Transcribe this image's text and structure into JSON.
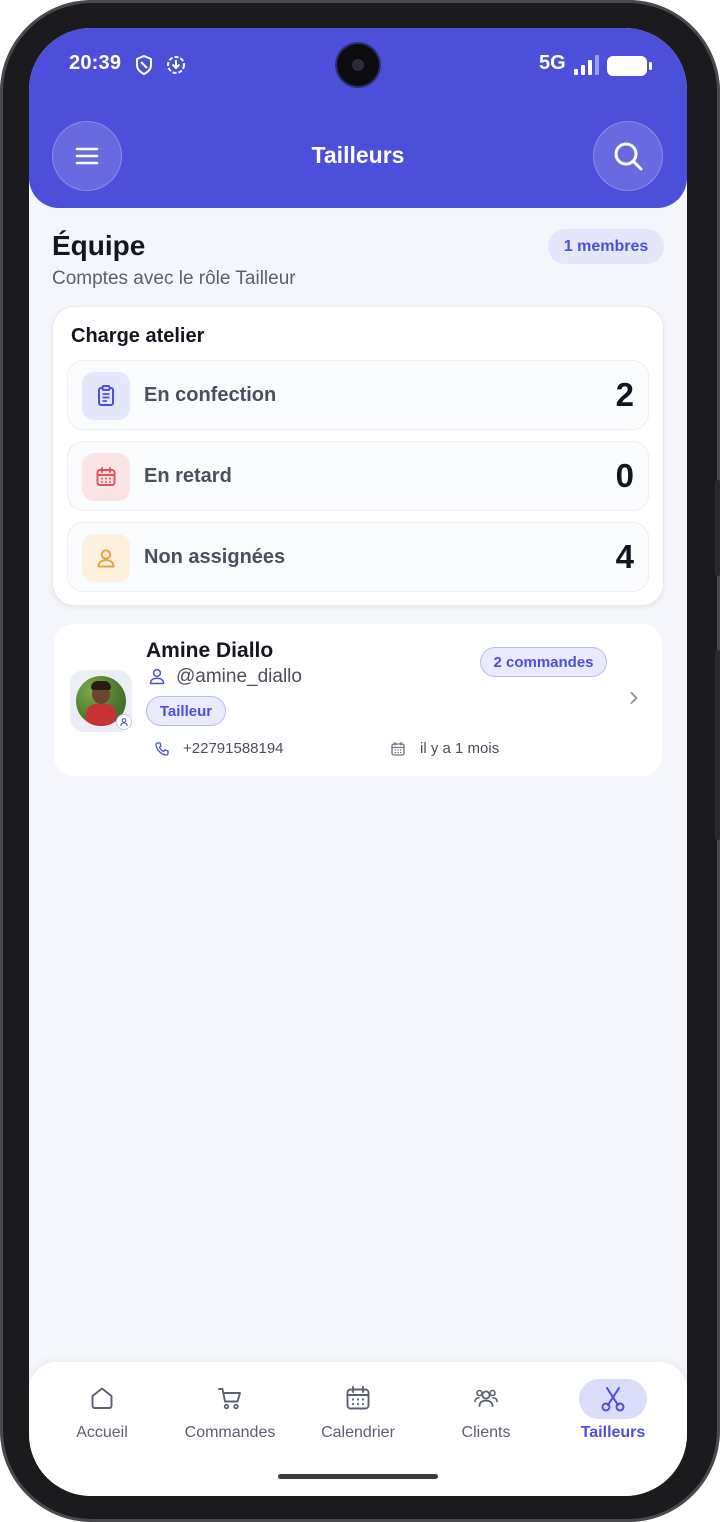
{
  "status_bar": {
    "time": "20:39",
    "network": "5G"
  },
  "header": {
    "title": "Tailleurs",
    "menu_icon": "hamburger-menu-icon",
    "search_icon": "search-icon",
    "background_color": "#4c4fda"
  },
  "team": {
    "title": "Équipe",
    "subtitle": "Comptes avec le rôle Tailleur",
    "members_badge": "1 membres"
  },
  "workload": {
    "title": "Charge atelier",
    "rows": [
      {
        "label": "En confection",
        "value": "2",
        "icon": "clipboard-icon",
        "color": "#4c4fda"
      },
      {
        "label": "En retard",
        "value": "0",
        "icon": "calendar-icon",
        "color": "#e0525a"
      },
      {
        "label": "Non assignées",
        "value": "4",
        "icon": "user-icon",
        "color": "#e8a23a"
      }
    ]
  },
  "tailors": [
    {
      "name": "Amine Diallo",
      "handle": "@amine_diallo",
      "role": "Tailleur",
      "orders": "2 commandes",
      "phone": "+22791588194",
      "joined": "il y a 1 mois"
    }
  ],
  "bottom_nav": {
    "items": [
      {
        "label": "Accueil",
        "icon": "home-icon"
      },
      {
        "label": "Commandes",
        "icon": "cart-icon"
      },
      {
        "label": "Calendrier",
        "icon": "calendar-icon"
      },
      {
        "label": "Clients",
        "icon": "users-icon"
      },
      {
        "label": "Tailleurs",
        "icon": "scissors-icon"
      }
    ],
    "active": "Tailleurs",
    "accent_color": "#4c4fda"
  }
}
